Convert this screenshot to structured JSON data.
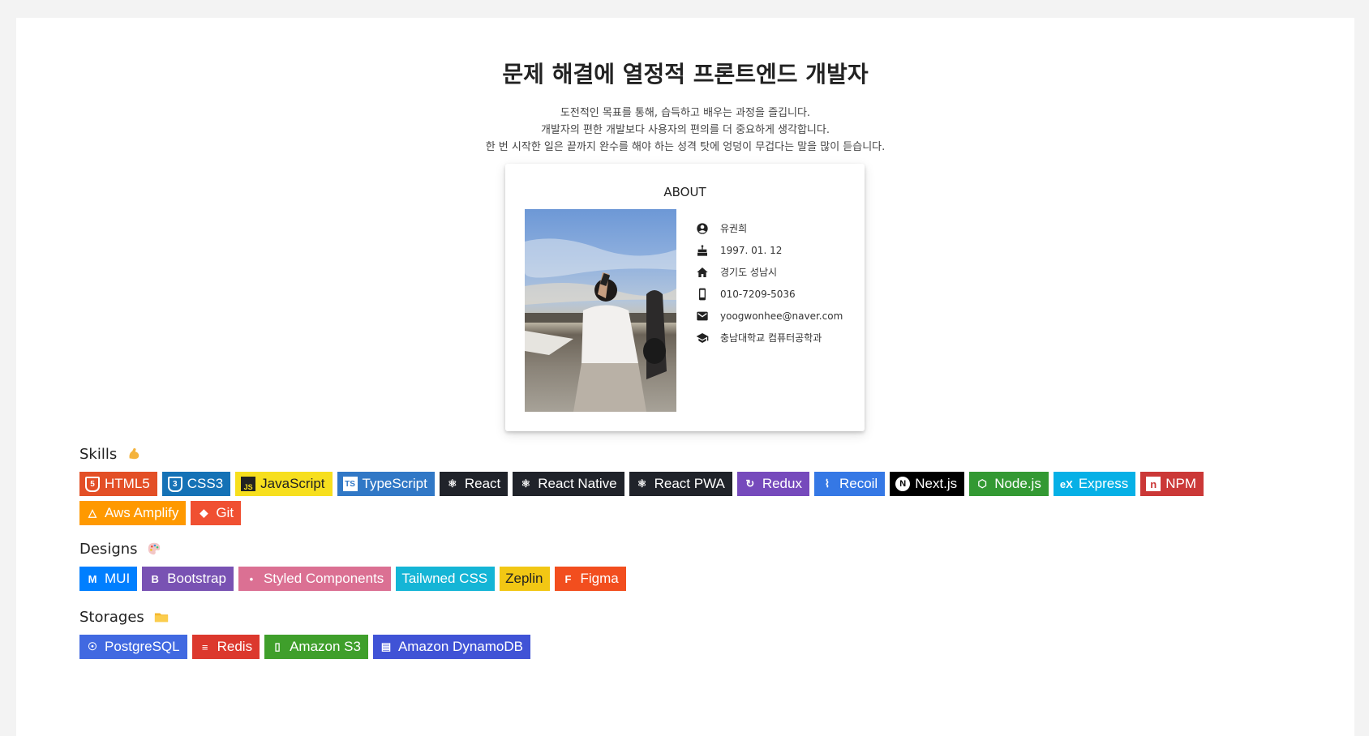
{
  "header": {
    "title": "문제 해결에 열정적 프론트엔드 개발자",
    "intro": [
      "도전적인 목표를 통해, 습득하고 배우는 과정을 즐깁니다.",
      "개발자의 편한 개발보다 사용자의 편의를 더 중요하게 생각합니다.",
      "한 번 시작한 일은 끝까지 완수를 해야 하는 성격 탓에 엉덩이 무겁다는 말을 많이 듣습니다."
    ]
  },
  "about": {
    "title": "ABOUT",
    "rows": [
      {
        "icon": "person-icon",
        "text": "유권희"
      },
      {
        "icon": "cake-icon",
        "text": "1997. 01. 12"
      },
      {
        "icon": "home-icon",
        "text": "경기도 성남시"
      },
      {
        "icon": "phone-icon",
        "text": "010-7209-5036"
      },
      {
        "icon": "mail-icon",
        "text": "yoogwonhee@naver.com"
      },
      {
        "icon": "school-icon",
        "text": "충남대학교 컴퓨터공학과"
      }
    ]
  },
  "sections": {
    "skills": {
      "title": "Skills",
      "badges": [
        {
          "label": "HTML5",
          "color": "#E34F26",
          "icon": "html5-icon"
        },
        {
          "label": "CSS3",
          "color": "#1572B6",
          "icon": "css3-icon"
        },
        {
          "label": "JavaScript",
          "color": "#F7DF1E",
          "icon": "javascript-icon"
        },
        {
          "label": "TypeScript",
          "color": "#3178C6",
          "icon": "typescript-icon"
        },
        {
          "label": "React",
          "color": "#20232A",
          "icon": "react-icon"
        },
        {
          "label": "React Native",
          "color": "#20232A",
          "icon": "react-icon"
        },
        {
          "label": "React PWA",
          "color": "#20232A",
          "icon": "react-icon"
        },
        {
          "label": "Redux",
          "color": "#764ABC",
          "icon": "redux-icon"
        },
        {
          "label": "Recoil",
          "color": "#3578E5",
          "icon": "recoil-icon"
        },
        {
          "label": "Next.js",
          "color": "#000000",
          "icon": "nextjs-icon"
        },
        {
          "label": "Node.js",
          "color": "#339933",
          "icon": "nodejs-icon"
        },
        {
          "label": "Express",
          "color": "#06B0E6",
          "icon": "express-icon"
        },
        {
          "label": "NPM",
          "color": "#CB3837",
          "icon": "npm-icon"
        },
        {
          "label": "Aws Amplify",
          "color": "#FF9900",
          "icon": "aws-amplify-icon"
        },
        {
          "label": "Git",
          "color": "#F05032",
          "icon": "git-icon"
        }
      ]
    },
    "designs": {
      "title": "Designs",
      "badges": [
        {
          "label": "MUI",
          "color": "#007FFF",
          "icon": "mui-icon"
        },
        {
          "label": "Bootstrap",
          "color": "#7952B3",
          "icon": "bootstrap-icon"
        },
        {
          "label": "Styled Components",
          "color": "#DB7093",
          "icon": "styled-components-icon"
        },
        {
          "label": "Tailwned CSS",
          "color": "#14B5D6",
          "icon": ""
        },
        {
          "label": "Zeplin",
          "color": "#F2C714",
          "icon": ""
        },
        {
          "label": "Figma",
          "color": "#F24E1E",
          "icon": "figma-icon"
        }
      ]
    },
    "storages": {
      "title": "Storages",
      "badges": [
        {
          "label": "PostgreSQL",
          "color": "#4169E1",
          "icon": "postgresql-icon"
        },
        {
          "label": "Redis",
          "color": "#DC382D",
          "icon": "redis-icon"
        },
        {
          "label": "Amazon S3",
          "color": "#3F9F2B",
          "icon": "amazon-s3-icon"
        },
        {
          "label": "Amazon DynamoDB",
          "color": "#4053D6",
          "icon": "dynamodb-icon"
        }
      ]
    }
  }
}
